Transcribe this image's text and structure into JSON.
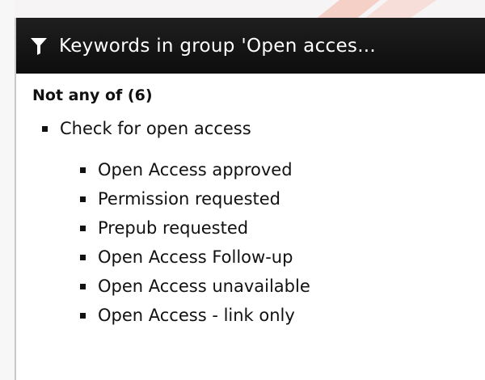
{
  "panel": {
    "title": "Keywords in group 'Open acces...",
    "icon": "filter-icon"
  },
  "group": {
    "heading": "Not any of (6)",
    "parent": {
      "label": "Check for open access",
      "children": [
        "Open Access approved",
        "Permission requested",
        "Prepub requested",
        "Open Access Follow-up",
        "Open Access unavailable",
        "Open Access - link only"
      ]
    }
  },
  "colors": {
    "header_bg": "#111111",
    "header_text": "#ffffff",
    "accent_deco": "#f3b8a8"
  }
}
